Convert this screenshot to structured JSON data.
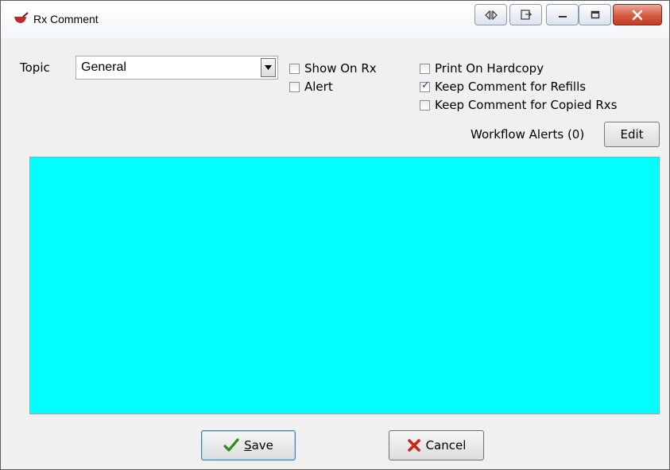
{
  "window": {
    "title": "Rx Comment",
    "controls": {
      "minimize_icon": "minimize-icon",
      "maximize_icon": "maximize-icon",
      "close_icon": "close-icon"
    }
  },
  "form": {
    "topic_label": "Topic",
    "topic_value": "General",
    "checkboxes": {
      "show_on_rx": {
        "label": "Show On Rx",
        "checked": false
      },
      "alert": {
        "label": "Alert",
        "checked": false
      },
      "print_on_hardcopy": {
        "label": "Print On Hardcopy",
        "checked": false
      },
      "keep_for_refills": {
        "label": "Keep Comment for Refills",
        "checked": true
      },
      "keep_for_copied": {
        "label": "Keep Comment for Copied Rxs",
        "checked": false
      }
    },
    "workflow_alerts_label": "Workflow Alerts",
    "workflow_alerts_count": "(0)",
    "edit_label": "Edit",
    "comment_text": "",
    "comment_bg": "#00ffff"
  },
  "buttons": {
    "save_accel": "S",
    "save_rest": "ave",
    "cancel_label": "Cancel"
  },
  "colors": {
    "save_check": "#2e8b1f",
    "cancel_x": "#c8261b",
    "app_icon": "#c0282d"
  }
}
